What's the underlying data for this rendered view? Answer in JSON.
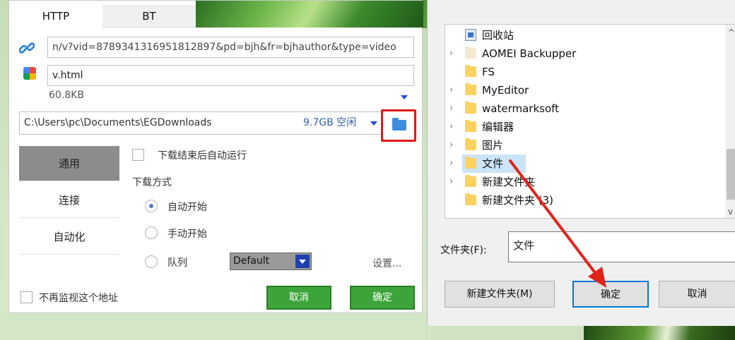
{
  "download_dialog": {
    "tabs": [
      "HTTP",
      "BT"
    ],
    "url": "n/v?vid=8789341316951812897&pd=bjh&fr=bjhauthor&type=video",
    "filename": "v.html",
    "size": "60.8KB",
    "save_path": "C:\\Users\\pc\\Documents\\EGDownloads",
    "free_space": "9.7GB 空闲",
    "nav": [
      "通用",
      "连接",
      "自动化"
    ],
    "auto_run_label": "下载结束后自动运行",
    "method_label": "下载方式",
    "radio_auto": "自动开始",
    "radio_manual": "手动开始",
    "radio_queue": "队列",
    "queue_select": "Default",
    "settings_link": "设置...",
    "no_monitor_label": "不再监视这个地址",
    "cancel": "取消",
    "ok": "确定"
  },
  "folder_dialog": {
    "tree": [
      {
        "label": "回收站",
        "icon": "recycle-bin-icon",
        "expandable": false
      },
      {
        "label": "AOMEI Backupper",
        "expandable": true
      },
      {
        "label": "FS",
        "expandable": false
      },
      {
        "label": "MyEditor",
        "expandable": true
      },
      {
        "label": "watermarksoft",
        "expandable": true
      },
      {
        "label": "编辑器",
        "expandable": true
      },
      {
        "label": "图片",
        "expandable": true
      },
      {
        "label": "文件",
        "expandable": true,
        "selected": true
      },
      {
        "label": "新建文件夹",
        "expandable": true
      },
      {
        "label": "新建文件夹 (3)",
        "expandable": false
      }
    ],
    "folder_label": "文件夹(F):",
    "folder_value": "文件",
    "new_folder": "新建文件夹(M)",
    "ok": "确定",
    "cancel": "取消"
  },
  "colors": {
    "green_button": "#3da43a",
    "selection": "#cce4f7",
    "highlight_red": "#e01818",
    "primary_border": "#0078d7"
  }
}
